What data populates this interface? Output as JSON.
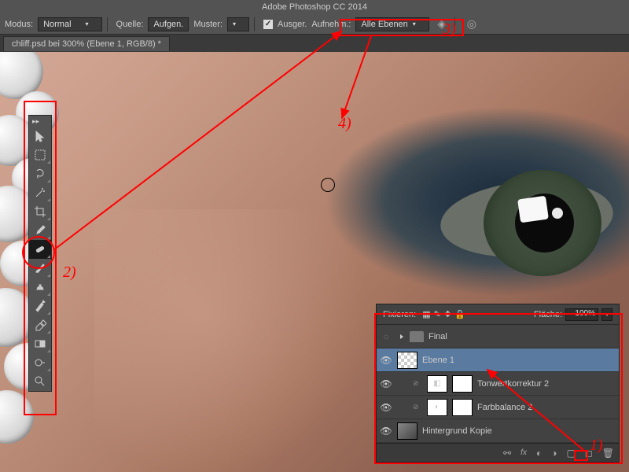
{
  "app": {
    "title": "Adobe Photoshop CC 2014"
  },
  "doc_tab": "chliff.psd bei 300% (Ebene 1, RGB/8) *",
  "options": {
    "modus_label": "Modus:",
    "modus_value": "Normal",
    "quelle_label": "Quelle:",
    "quelle_aufgen": "Aufgen.",
    "quelle_muster": "Muster:",
    "ausger_checked": true,
    "ausger_label": "Ausger.",
    "aufnehm_label": "Aufnehm.:",
    "aufnehm_value": "Alle Ebenen"
  },
  "layers": {
    "fixieren_label": "Fixieren:",
    "flaeche_label": "Fläche:",
    "flaeche_value": "100%",
    "items": [
      {
        "name": "Final",
        "type": "group"
      },
      {
        "name": "Ebene 1",
        "type": "layer",
        "selected": true,
        "thumb": "trans"
      },
      {
        "name": "Tonwertkorrektur 2",
        "type": "adj",
        "adj": "levels"
      },
      {
        "name": "Farbbalance 2",
        "type": "adj",
        "adj": "balance"
      },
      {
        "name": "Hintergrund Kopie",
        "type": "layer",
        "thumb": "img"
      }
    ]
  },
  "annotations": {
    "a1": "1)",
    "a2": "2)",
    "a3": "3)",
    "a4": "4)"
  },
  "icons": {
    "move": "move-icon",
    "marquee": "marquee-icon",
    "lasso": "lasso-icon",
    "wand": "wand-icon",
    "crop": "crop-icon",
    "eyedrop": "eyedropper-icon",
    "heal": "healing-brush-icon",
    "brush": "brush-icon",
    "stamp": "clone-stamp-icon",
    "history": "history-brush-icon",
    "eraser": "eraser-icon",
    "gradient": "gradient-icon",
    "dodge": "dodge-icon",
    "zoom": "zoom-icon"
  }
}
